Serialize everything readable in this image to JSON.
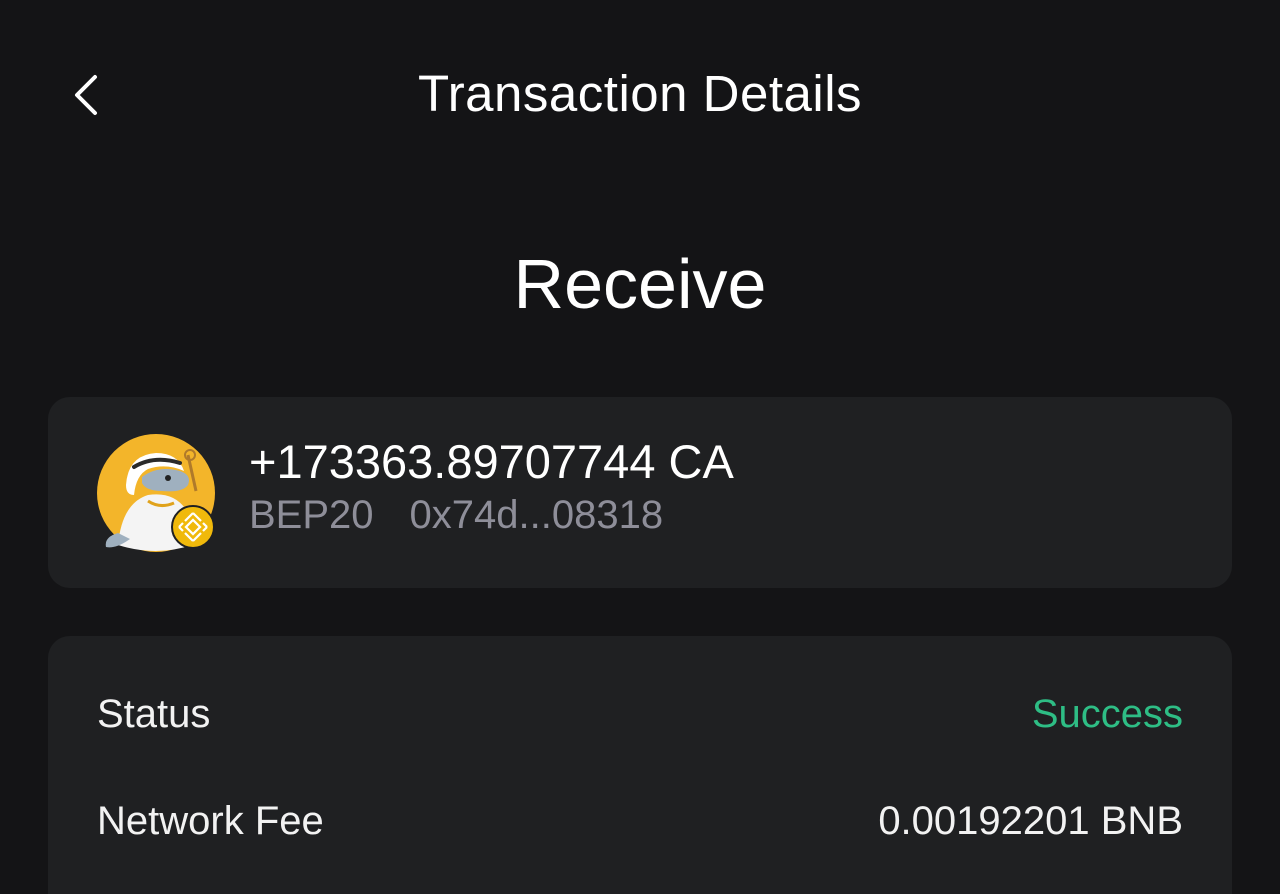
{
  "header": {
    "title": "Transaction Details",
    "back_icon": "chevron-left-icon"
  },
  "transaction": {
    "type": "Receive"
  },
  "asset": {
    "amount": "+173363.89707744 CA",
    "network": "BEP20",
    "address": "0x74d...08318",
    "avatar_icon": "token-avatar",
    "network_badge_icon": "bnb-chain-badge-icon"
  },
  "details": {
    "status": {
      "label": "Status",
      "value": "Success"
    },
    "network_fee": {
      "label": "Network Fee",
      "value": "0.00192201 BNB"
    }
  },
  "colors": {
    "background": "#141416",
    "card": "#1f2022",
    "success": "#2ebd85",
    "muted": "#8e8e99",
    "avatar_yellow": "#f3b52a"
  }
}
